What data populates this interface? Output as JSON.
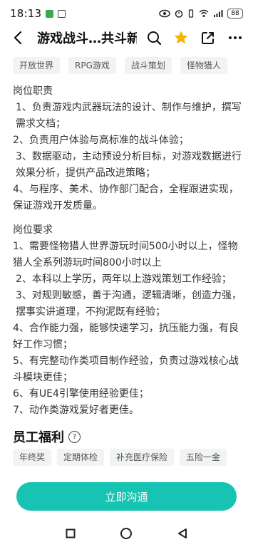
{
  "status_bar": {
    "time": "18:13",
    "battery": "88"
  },
  "app_bar": {
    "title": "游戏战斗…共斗新游"
  },
  "tags": [
    "开放世界",
    "RPG游戏",
    "战斗策划",
    "怪物猎人"
  ],
  "duties": {
    "title": "岗位职责",
    "items": [
      "1、负责游戏内武器玩法的设计、制作与维护，撰写需求文档；",
      "2、负责用户体验与高标准的战斗体验；",
      "3、数据驱动，主动预设分析目标，对游戏数据进行效果分析，提供产品改进策略；",
      "4、与程序、美术、协作部门配合，全程跟进实现，保证游戏开发质量。"
    ]
  },
  "requirements": {
    "title": "岗位要求",
    "items": [
      "1、需要怪物猎人世界游玩时间500小时以上，怪物猎人全系列游玩时间800小时以上",
      "2、本科以上学历，两年以上游戏策划工作经验；",
      "3、对规则敏感，善于沟通，逻辑清晰，创造力强，摆事实讲道理，不拘泥既有经验；",
      "4、合作能力强，能够快速学习，抗压能力强，有良好工作习惯；",
      "5、有完整动作类项目制作经验，负责过游戏核心战斗模块更佳；",
      "6、有UE4引擎使用经验更佳；",
      "7、动作类游戏爱好者更佳。"
    ]
  },
  "benefits": {
    "title": "员工福利",
    "help_icon_text": "?",
    "items": [
      "年终奖",
      "定期体检",
      "补充医疗保险",
      "五险一金"
    ]
  },
  "contact_button": "立即沟通",
  "colors": {
    "accent": "#17c3b2",
    "star": "#f5b400"
  }
}
